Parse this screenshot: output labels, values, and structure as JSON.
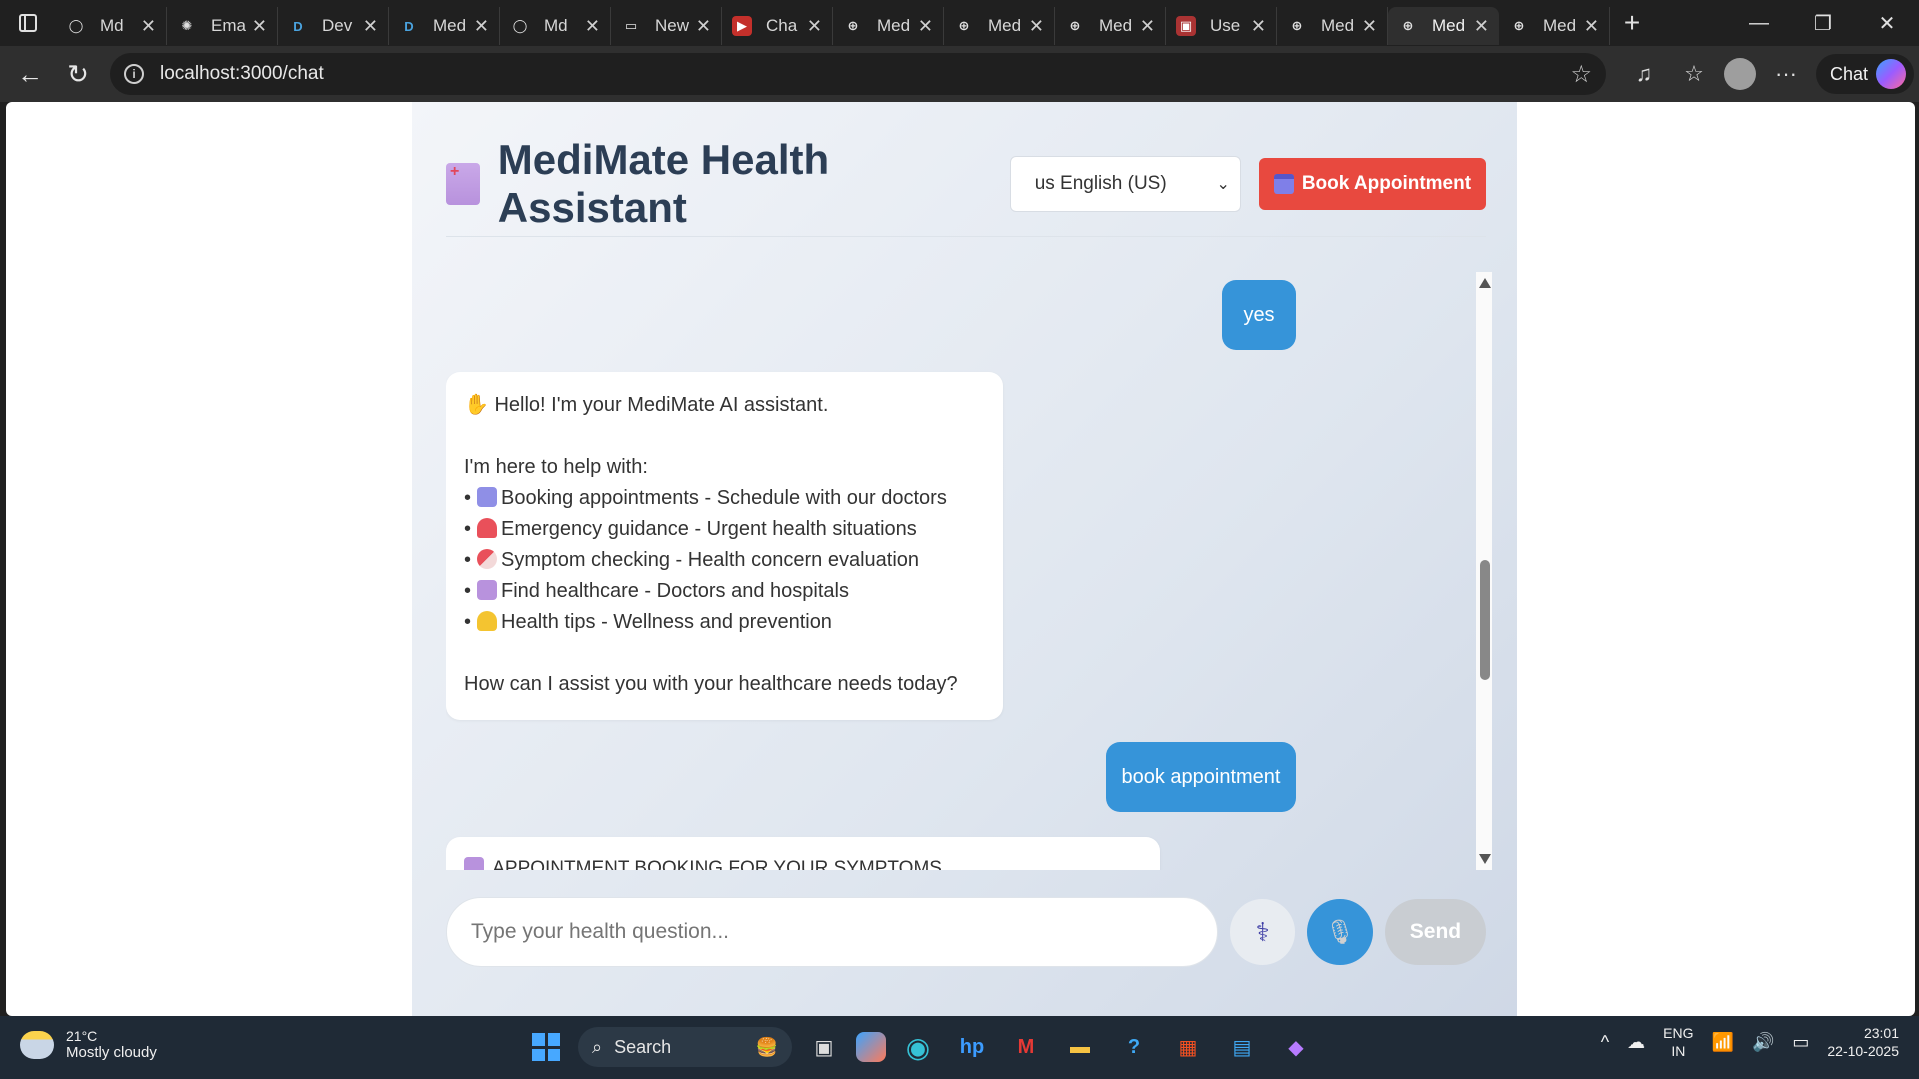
{
  "browser": {
    "tabs": [
      {
        "title": "Md",
        "favicon": "github-icon",
        "active": false
      },
      {
        "title": "Ema",
        "favicon": "openai-icon",
        "active": false
      },
      {
        "title": "Dev",
        "favicon": "D",
        "active": false
      },
      {
        "title": "Med",
        "favicon": "D",
        "active": false
      },
      {
        "title": "Md",
        "favicon": "github-icon",
        "active": false
      },
      {
        "title": "New",
        "favicon": "page-icon",
        "active": false
      },
      {
        "title": "Cha",
        "favicon": "youtube-icon",
        "active": false
      },
      {
        "title": "Med",
        "favicon": "globe-icon",
        "active": false
      },
      {
        "title": "Med",
        "favicon": "globe-icon",
        "active": false
      },
      {
        "title": "Med",
        "favicon": "globe-icon",
        "active": false
      },
      {
        "title": "Use",
        "favicon": "red-app-icon",
        "active": false
      },
      {
        "title": "Med",
        "favicon": "globe-icon",
        "active": false
      },
      {
        "title": "Med",
        "favicon": "globe-icon",
        "active": true
      },
      {
        "title": "Med",
        "favicon": "globe-icon",
        "active": false
      }
    ],
    "url": "localhost:3000/chat",
    "chat_button_label": "Chat"
  },
  "app": {
    "title": "MediMate Health Assistant",
    "language_selected": "us English (US)",
    "book_button_label": "Book Appointment",
    "messages": {
      "user_1": "yes",
      "bot_1": {
        "greeting": "Hello! I'm your MediMate AI assistant.",
        "intro": "I'm here to help with:",
        "items": [
          "Booking appointments - Schedule with our doctors",
          "Emergency guidance - Urgent health situations",
          "Symptom checking - Health concern evaluation",
          "Find healthcare - Doctors and hospitals",
          "Health tips - Wellness and prevention"
        ],
        "closing": "How can I assist you with your healthcare needs today?"
      },
      "user_2": "book appointment",
      "bot_2_partial": "APPOINTMENT BOOKING FOR YOUR SYMPTOMS"
    },
    "input_placeholder": "Type your health question...",
    "send_label": "Send"
  },
  "taskbar": {
    "temperature": "21°C",
    "weather": "Mostly cloudy",
    "search_label": "Search",
    "lang_top": "ENG",
    "lang_bottom": "IN",
    "time": "23:01",
    "date": "22-10-2025"
  },
  "colors": {
    "accent_blue": "#3694d9",
    "book_red": "#e8493f",
    "title_navy": "#2c3e55"
  }
}
